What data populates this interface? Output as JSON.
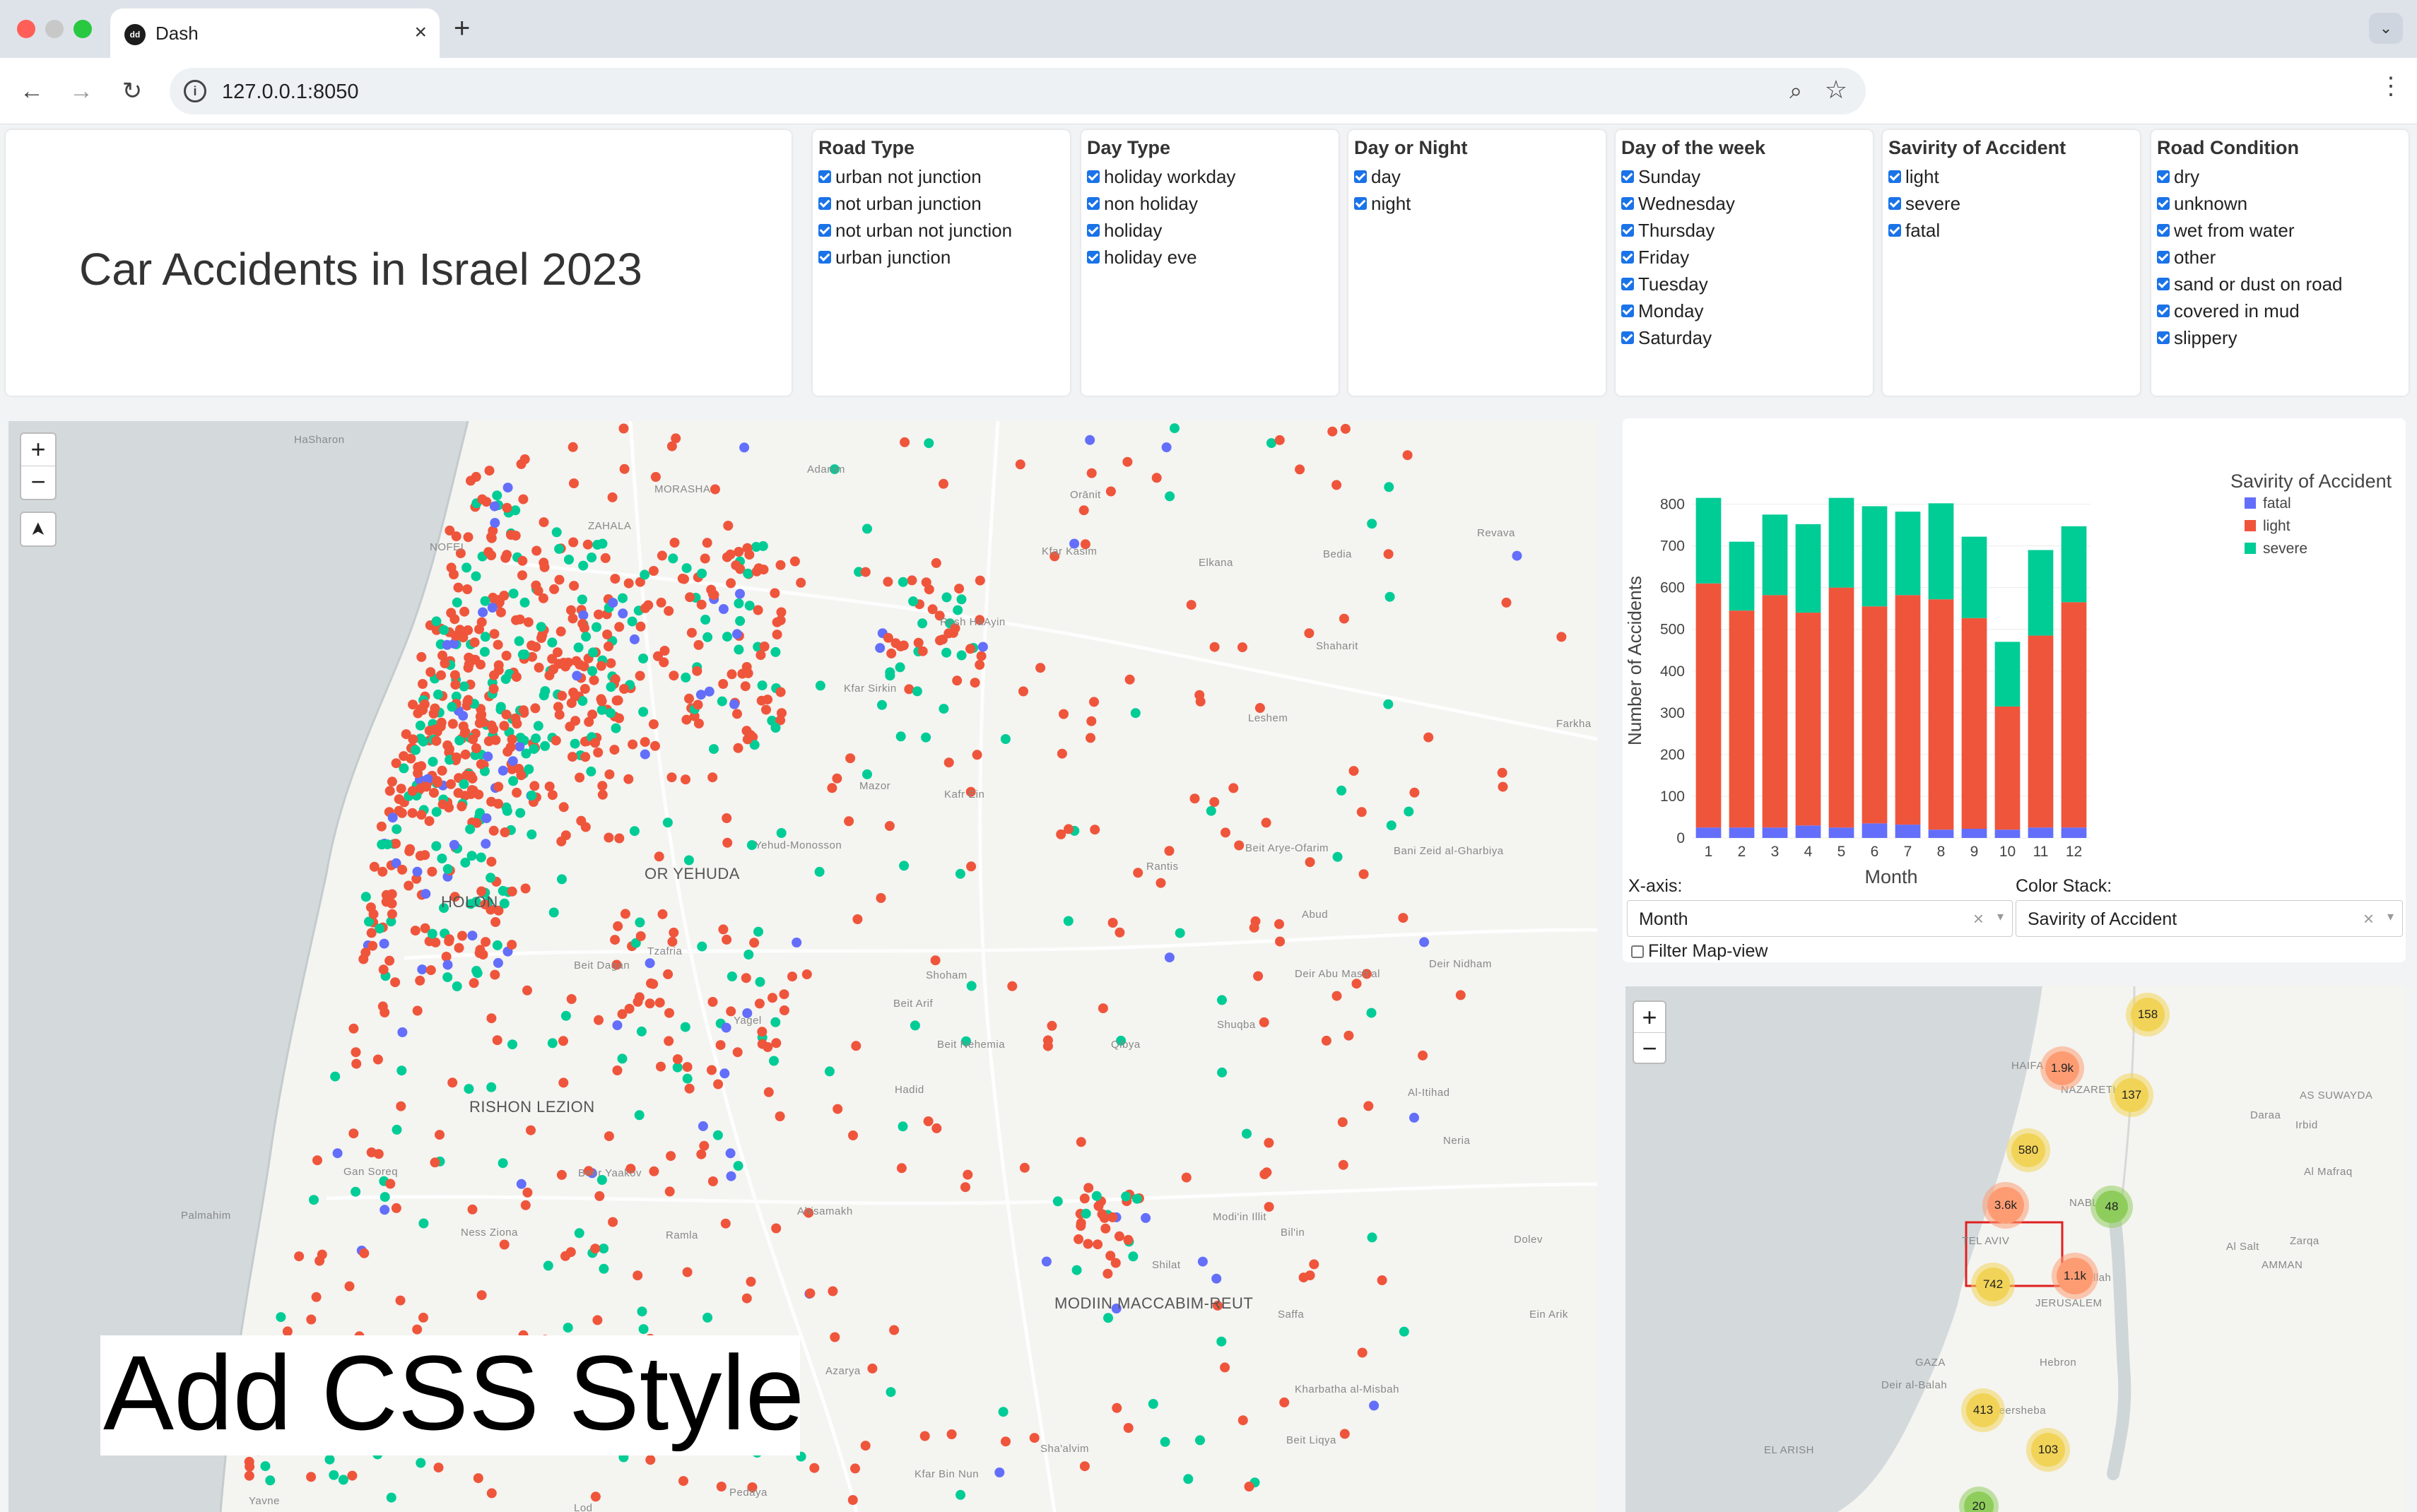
{
  "browser": {
    "tab_title": "Dash",
    "tab_close": "×",
    "new_tab": "+",
    "url": "127.0.0.1:8050",
    "back": "←",
    "forward": "→",
    "reload": "↻",
    "site_info": "i",
    "zoom": "⌕",
    "star": "☆",
    "menu": "⋮",
    "tab_dropdown": "⌄"
  },
  "header": {
    "title": "Car Accidents in Israel 2023"
  },
  "filters": [
    {
      "title": "Road Type",
      "items": [
        "urban not junction",
        "not urban junction",
        "not urban not junction",
        "urban junction"
      ]
    },
    {
      "title": "Day Type",
      "items": [
        "holiday workday",
        "non holiday",
        "holiday",
        "holiday eve"
      ]
    },
    {
      "title": "Day or Night",
      "items": [
        "day",
        "night"
      ]
    },
    {
      "title": "Day of the week",
      "items": [
        "Sunday",
        "Wednesday",
        "Thursday",
        "Friday",
        "Tuesday",
        "Monday",
        "Saturday"
      ]
    },
    {
      "title": "Savirity of Accident",
      "items": [
        "light",
        "severe",
        "fatal"
      ]
    },
    {
      "title": "Road Condition",
      "items": [
        "dry",
        "unknown",
        "wet from water",
        "other",
        "sand or dust on road",
        "covered in mud",
        "slippery"
      ]
    }
  ],
  "big_map": {
    "zoom_in": "+",
    "zoom_out": "−",
    "locate": "➤",
    "place_labels": [
      "HaSharon",
      "Adanim",
      "MORASHA",
      "ZAHALA",
      "NOFEI",
      "Kfar Kasim",
      "Orānit",
      "Bedia",
      "Revava",
      "Rosh HaAyin",
      "Elkana",
      "Shaharit",
      "Kfar Sirkin",
      "Leshem",
      "Farkha",
      "Mazor",
      "Kafr Ein",
      "OR YEHUDA",
      "Yehud-Monosson",
      "Beit Arye-Ofarim",
      "Bani Zeid al-Gharbiya",
      "Rantis",
      "HOLON",
      "Abud",
      "Tzafria",
      "Beit Dagan",
      "Deir Abu Mash'al",
      "Deir Nidham",
      "Shoham",
      "Beit Arif",
      "Yagel",
      "Shuqba",
      "Beit Nehemia",
      "Qibya",
      "RISHON LEZION",
      "Hadid",
      "Al-Itihad",
      "Gan Soreq",
      "Beer Yaakov",
      "Neria",
      "Palmahim",
      "Ahisamakh",
      "Modi'in Illit",
      "Bil'in",
      "Dolev",
      "Ness Ziona",
      "Ramla",
      "Shilat",
      "MODIIN MACCABIM-REUT",
      "Saffa",
      "Ein Arik",
      "Azarya",
      "Kharbatha al-Misbah",
      "Beit Liqya",
      "Sha'alvim",
      "Kfar Bin Nun",
      "Pedaya",
      "Yavne",
      "Lod"
    ],
    "overlay_text": "Add CSS Style"
  },
  "chart_panel": {
    "xaxis_label": "X-axis:",
    "xaxis_value": "Month",
    "color_label": "Color Stack:",
    "color_value": "Savirity of Accident",
    "clear_symbol": "×",
    "arrow_symbol": "▾",
    "filter_label": "Filter Map-view"
  },
  "chart_data": {
    "type": "bar",
    "stacked": true,
    "categories": [
      "1",
      "2",
      "3",
      "4",
      "5",
      "6",
      "7",
      "8",
      "9",
      "10",
      "11",
      "12"
    ],
    "xlabel": "Month",
    "ylabel": "Number of Accidents",
    "ylim": [
      0,
      850
    ],
    "yticks": [
      0,
      100,
      200,
      300,
      400,
      500,
      600,
      700,
      800
    ],
    "legend_title": "Savirity of Accident",
    "legend_position": "top-right",
    "series": [
      {
        "name": "fatal",
        "color": "#636efa",
        "values": [
          25,
          25,
          25,
          30,
          25,
          35,
          32,
          20,
          22,
          20,
          25,
          25
        ]
      },
      {
        "name": "light",
        "color": "#ef553b",
        "values": [
          585,
          520,
          557,
          510,
          575,
          520,
          550,
          552,
          505,
          295,
          460,
          540
        ]
      },
      {
        "name": "severe",
        "color": "#00cc96",
        "values": [
          205,
          165,
          193,
          212,
          215,
          240,
          200,
          230,
          195,
          155,
          205,
          182
        ]
      }
    ]
  },
  "small_map": {
    "zoom_in": "+",
    "zoom_out": "−",
    "place_labels": [
      "HAIFA",
      "NAZARETH",
      "AS SUWAYDA",
      "Daraa",
      "Irbid",
      "Al Mafraq",
      "NABLUS",
      "Al Salt",
      "Zarqa",
      "AMMAN",
      "Ramallah",
      "JERUSALEM",
      "Hebron",
      "GAZA",
      "Deir al-Balah",
      "Beersheba",
      "EL ARISH",
      "TEL AVIV"
    ],
    "clusters": [
      {
        "label": "158",
        "color": "#f1d357"
      },
      {
        "label": "1.9k",
        "color": "#fd9c73"
      },
      {
        "label": "137",
        "color": "#f1d357"
      },
      {
        "label": "580",
        "color": "#f1d357"
      },
      {
        "label": "48",
        "color": "#8ecd5c"
      },
      {
        "label": "3.6k",
        "color": "#fd9c73"
      },
      {
        "label": "1.1k",
        "color": "#fd9c73"
      },
      {
        "label": "742",
        "color": "#f1d357"
      },
      {
        "label": "413",
        "color": "#f1d357"
      },
      {
        "label": "103",
        "color": "#f1d357"
      },
      {
        "label": "20",
        "color": "#8ecd5c"
      }
    ]
  }
}
